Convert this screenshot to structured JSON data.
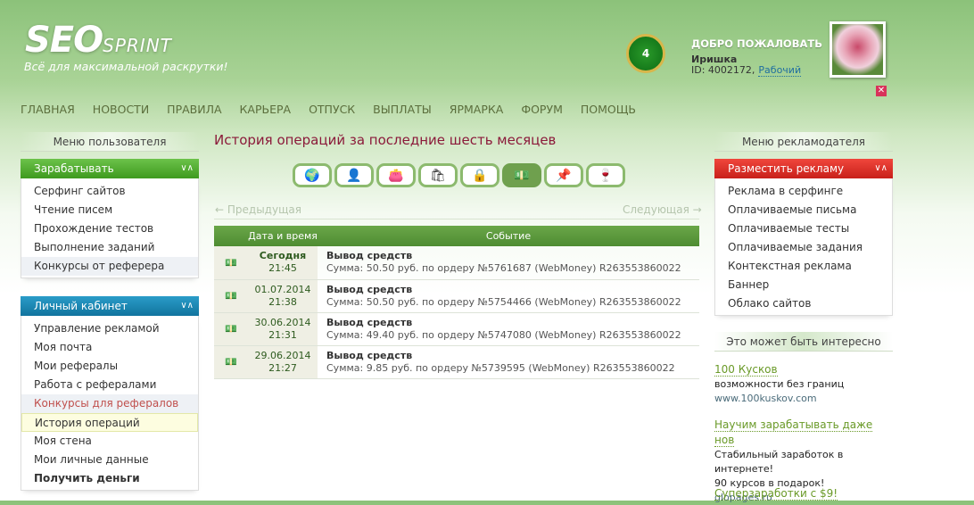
{
  "header": {
    "logo_main": "SEO",
    "logo_sub": "SPRINT",
    "tagline": "Всё для максимальной раскрутки!",
    "welcome": "ДОБРО ПОЖАЛОВАТЬ",
    "username": "Иришка",
    "user_id": "ID: 4002172,",
    "status": "Рабочий",
    "level": "4",
    "close": "✕"
  },
  "nav": [
    "ГЛАВНАЯ",
    "НОВОСТИ",
    "ПРАВИЛА",
    "КАРЬЕРА",
    "ОТПУСК",
    "ВЫПЛАТЫ",
    "ЯРМАРКА",
    "ФОРУМ",
    "ПОМОЩЬ"
  ],
  "left": {
    "heading": "Меню пользователя",
    "earn": {
      "title": "Зарабатывать",
      "items": [
        "Серфинг сайтов",
        "Чтение писем",
        "Прохождение тестов",
        "Выполнение заданий",
        "Конкурсы от реферера"
      ]
    },
    "cabinet": {
      "title": "Личный кабинет",
      "items": [
        "Управление рекламой",
        "Моя почта",
        "Мои рефералы",
        "Работа с рефералами",
        "Конкурсы для рефералов",
        "История операций",
        "Моя стена",
        "Мои личные данные",
        "Получить деньги"
      ]
    }
  },
  "main": {
    "title": "История операций за последние шесть месяцев",
    "prev": "← Предыдущая",
    "next": "Следующая →",
    "columns": [
      "Дата и время",
      "Событие"
    ],
    "rows": [
      {
        "date": "Сегодня",
        "time": "21:45",
        "event": "Вывод средств",
        "detail": "Сумма: 50.50 руб. по ордеру №5761687 (WebMoney) R263553860022"
      },
      {
        "date": "01.07.2014",
        "time": "21:38",
        "event": "Вывод средств",
        "detail": "Сумма: 50.50 руб. по ордеру №5754466 (WebMoney) R263553860022"
      },
      {
        "date": "30.06.2014",
        "time": "21:31",
        "event": "Вывод средств",
        "detail": "Сумма: 49.40 руб. по ордеру №5747080 (WebMoney) R263553860022"
      },
      {
        "date": "29.06.2014",
        "time": "21:27",
        "event": "Вывод средств",
        "detail": "Сумма: 9.85 руб. по ордеру №5739595 (WebMoney) R263553860022"
      }
    ]
  },
  "right": {
    "heading": "Меню рекламодателя",
    "place": {
      "title": "Разместить рекламу",
      "items": [
        "Реклама в серфинге",
        "Оплачиваемые письма",
        "Оплачиваемые тесты",
        "Оплачиваемые задания",
        "Контекстная реклама",
        "Баннер",
        "Облако сайтов"
      ]
    },
    "interest": "Это может быть интересно",
    "ads": [
      {
        "title": "100 Кусков",
        "lines": [
          "возможности без границ"
        ],
        "url": "www.100kuskov.com"
      },
      {
        "title": "Научим зарабатывать даже нов",
        "lines": [
          "Стабильный заработок в интернете!",
          "90 курсов в подарок!"
        ],
        "url": "glopages.ru"
      },
      {
        "title": "Суперзаработки с $9!"
      }
    ]
  },
  "colors": {
    "green": "#4e8c32",
    "red": "#c8201a",
    "blue": "#11749e",
    "title": "#8b1a3a"
  }
}
